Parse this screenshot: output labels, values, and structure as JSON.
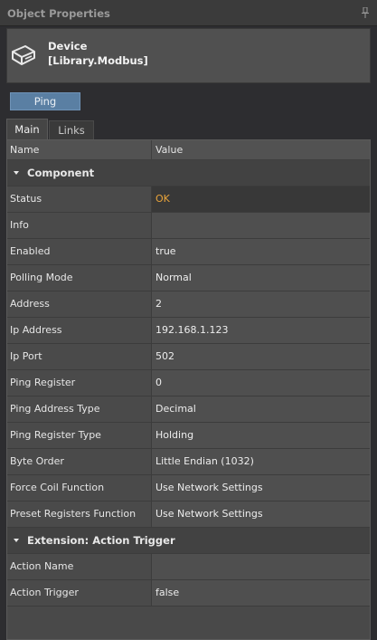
{
  "panel": {
    "title": "Object Properties"
  },
  "header": {
    "name": "Device",
    "type": "[Library.Modbus]"
  },
  "actions": {
    "ping_label": "Ping"
  },
  "tabs": [
    "Main",
    "Links"
  ],
  "grid": {
    "col_name": "Name",
    "col_value": "Value",
    "categories": [
      {
        "label": "Component",
        "rows": [
          {
            "name": "Status",
            "value": "OK"
          },
          {
            "name": "Info",
            "value": ""
          },
          {
            "name": "Enabled",
            "value": "true"
          },
          {
            "name": "Polling Mode",
            "value": "Normal"
          },
          {
            "name": "Address",
            "value": "2"
          },
          {
            "name": "Ip Address",
            "value": "192.168.1.123"
          },
          {
            "name": "Ip Port",
            "value": "502"
          },
          {
            "name": "Ping Register",
            "value": "0"
          },
          {
            "name": "Ping Address Type",
            "value": "Decimal"
          },
          {
            "name": "Ping Register Type",
            "value": "Holding"
          },
          {
            "name": "Byte Order",
            "value": "Little Endian (1032)"
          },
          {
            "name": "Force Coil Function",
            "value": "Use Network Settings"
          },
          {
            "name": "Preset Registers Function",
            "value": "Use Network Settings"
          }
        ]
      },
      {
        "label": "Extension: Action Trigger",
        "rows": [
          {
            "name": "Action Name",
            "value": ""
          },
          {
            "name": "Action Trigger",
            "value": "false"
          }
        ]
      }
    ]
  },
  "colors": {
    "status_ok": "#e8a33a",
    "ping_button": "#5a7fa3"
  },
  "icons": {
    "pin": "pin-icon",
    "device": "device-icon",
    "collapse": "caret-down-icon"
  }
}
